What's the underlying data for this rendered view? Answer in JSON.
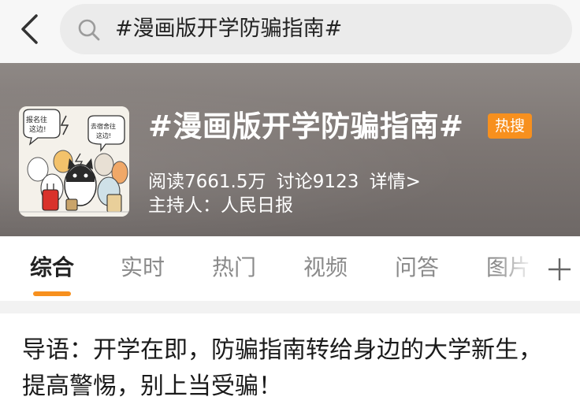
{
  "search": {
    "query": "#漫画版开学防骗指南#"
  },
  "topic": {
    "title": "#漫画版开学防骗指南#",
    "badge": "热搜",
    "reads": "阅读7661.5万",
    "discussions": "讨论9123",
    "details": "详情>",
    "host": "主持人：人民日报",
    "cover_caption_left": "报名往这边!",
    "cover_caption_right": "去宿舍往这边!"
  },
  "tabs": [
    {
      "label": "综合",
      "active": true
    },
    {
      "label": "实时"
    },
    {
      "label": "热门"
    },
    {
      "label": "视频"
    },
    {
      "label": "问答"
    },
    {
      "label": "图片"
    }
  ],
  "intro": {
    "text": "导语：开学在即，防骗指南转给身边的大学新生，提高警惕，别上当受骗！"
  },
  "colors": {
    "accent": "#f7901e",
    "banner": "#7e7774",
    "tab_inactive": "#8a8a8a"
  },
  "icons": {
    "back": "chevron-left-icon",
    "search": "search-icon",
    "more": "plus-icon"
  }
}
